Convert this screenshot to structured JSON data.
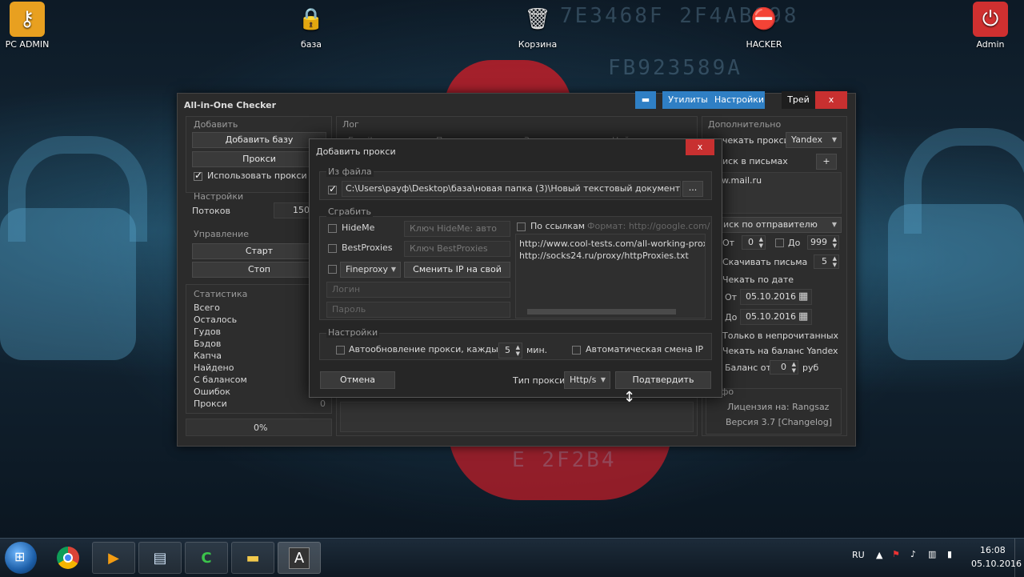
{
  "desktop": {
    "icons": [
      {
        "label": "PC ADMIN",
        "icon": "key-icon"
      },
      {
        "label": "база",
        "icon": "lock-icon"
      },
      {
        "label": "Корзина",
        "icon": "recycle-bin-icon"
      },
      {
        "label": "HACKER",
        "icon": "no-entry-icon"
      },
      {
        "label": "Admin",
        "icon": "power-icon"
      }
    ]
  },
  "main_window": {
    "title": "All-in-One Checker",
    "titlebar_buttons": {
      "folder": "folder-icon",
      "utilities": "Утилиты",
      "settings": "Настройки",
      "tray": "Трей",
      "close": "x"
    },
    "add_group": {
      "label": "Добавить",
      "add_base": "Добавить базу",
      "proxies": "Прокси",
      "use_proxies": "Использовать прокси"
    },
    "settings_group": {
      "label": "Настройки",
      "threads_label": "Потоков",
      "threads_value": "150"
    },
    "control_group": {
      "label": "Управление",
      "start": "Старт",
      "stop": "Стоп"
    },
    "stats_group": {
      "label": "Статистика",
      "rows": [
        "Всего",
        "Осталось",
        "Гудов",
        "Бэдов",
        "Капча",
        "Найдено",
        "С балансом",
        "Ошибок",
        "Прокси"
      ],
      "proxies_value": "0",
      "progress": "0%"
    },
    "log_group": {
      "label": "Лог",
      "columns": [
        "Email",
        "Пароль",
        "Запрос",
        "Найдено"
      ]
    },
    "extra_group": {
      "label": "Дополнительно",
      "check_proxies": "чекать прокси",
      "proxy_engine": "Yandex",
      "search_in_mail": "иск в письмах",
      "plus": "+",
      "mail_entry": "w.mail.ru",
      "search_by_sender": "иск по отправителю",
      "from_label": "От",
      "from_value": "0",
      "to_label": "До",
      "to_value": "999",
      "download_letters": "Скачивать письма",
      "download_value": "5",
      "check_by_date": "Чекать по дате",
      "date_from_label": "От",
      "date_from": "05.10.2016",
      "date_to_label": "До",
      "date_to": "05.10.2016",
      "only_unread": "Только в непрочитанных",
      "check_yandex_balance": "Чекать на баланс Yandex",
      "balance_from": "Баланс от",
      "balance_value": "0",
      "currency": "руб",
      "info_label": "фо",
      "license": "Лицензия на: Rangsaz",
      "version": "Версия 3.7 [Changelog]"
    }
  },
  "modal": {
    "title": "Добавить прокси",
    "close": "x",
    "from_file": {
      "label": "Из файла",
      "path": "C:\\Users\\рауф\\Desktop\\база\\новая папка (3)\\Новый текстовый документ.txt",
      "browse": "..."
    },
    "scrape": {
      "label": "Сграбить",
      "hideme": "HideMe",
      "hideme_key_placeholder": "Ключ HideMe: авто",
      "bestproxies": "BestProxies",
      "bestproxies_key_placeholder": "Ключ BestProxies",
      "fineproxy": "Fineproxy",
      "change_ip": "Сменить IP на свой",
      "login_placeholder": "Логин",
      "password_placeholder": "Пароль",
      "by_links": "По ссылкам",
      "format_hint": "Формат: http://google.com/",
      "links": [
        "http://www.cool-tests.com/all-working-proxies",
        "http://socks24.ru/proxy/httpProxies.txt"
      ]
    },
    "settings": {
      "label": "Настройки",
      "auto_update": "Автообновление прокси, каждые",
      "auto_update_value": "5",
      "minutes": "мин.",
      "auto_change_ip": "Автоматическая смена IP"
    },
    "cancel": "Отмена",
    "proxy_type_label": "Тип прокси",
    "proxy_type": "Http/s",
    "confirm": "Подтвердить"
  },
  "taskbar": {
    "apps": [
      "start-orb",
      "chrome-icon",
      "media-player-icon",
      "notepad-icon",
      "camtasia-icon",
      "explorer-icon",
      "app-a-icon"
    ],
    "app_a_label": "A",
    "lang": "RU",
    "time": "16:08",
    "date": "05.10.2016"
  }
}
